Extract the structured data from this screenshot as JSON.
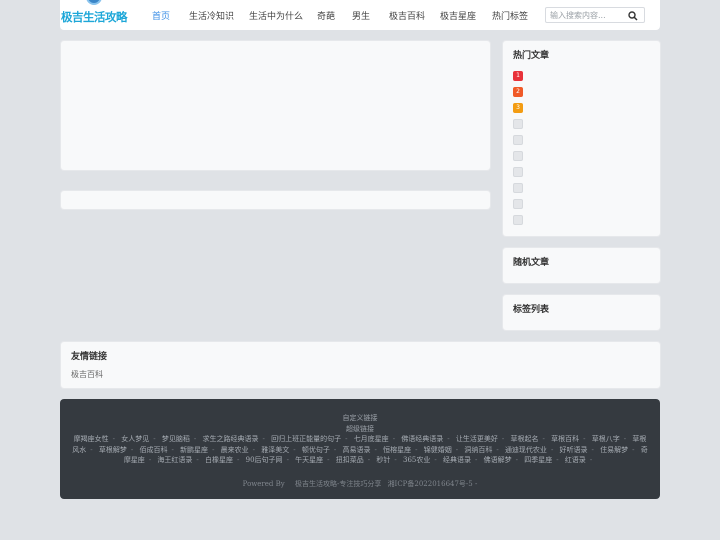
{
  "header": {
    "logo_text": "极吉生活攻略",
    "nav": [
      "首页",
      "生活冷知识",
      "生活中为什么",
      "奇葩",
      "男生",
      "极吉百科",
      "极吉星座",
      "热门标签"
    ],
    "search_placeholder": "输入搜索内容..."
  },
  "sidebar": {
    "hot_title": "热门文章",
    "hot_ranks": [
      "1",
      "2",
      "3",
      "",
      "",
      "",
      "",
      "",
      "",
      ""
    ],
    "random_title": "随机文章",
    "tags_title": "标签列表"
  },
  "friends": {
    "title": "友情链接",
    "link": "极吉百科"
  },
  "footer": {
    "custom_link": "自定义链接",
    "super_link": "超级链接",
    "links": [
      "摩羯座女性",
      "女人梦见",
      "梦见脑稻",
      "求生之路经典语录",
      "回归上班正能量的句子",
      "七月底星座",
      "佛语经典语录",
      "让生活更美好",
      "草根起名",
      "草根百科",
      "草根八字",
      "草根风水",
      "草根解梦",
      "佰成百科",
      "新鹏星座",
      "晨来农业",
      "雅泽美文",
      "顿优句子",
      "高易语录",
      "恒榕星座",
      "锦健婚姻",
      "洞纳百科",
      "通迪现代农业",
      "好听语录",
      "住易解梦",
      "奇摩星座",
      "海王红语录",
      "白橡星座",
      "90后句子网",
      "午天星座",
      "扭扣菜品",
      "秒针",
      "365农业",
      "经典语录",
      "佛语解梦",
      "四季星座",
      "红语录"
    ],
    "powered_by": "Powered By",
    "site_name": "极吉生活攻略-专注技巧分享",
    "icp": "湘ICP备2022016647号-5"
  },
  "colors": {
    "rank1": "#e8323a",
    "rank2": "#f05a28",
    "rank3": "#f39c12",
    "accent": "#3a8ee6"
  }
}
